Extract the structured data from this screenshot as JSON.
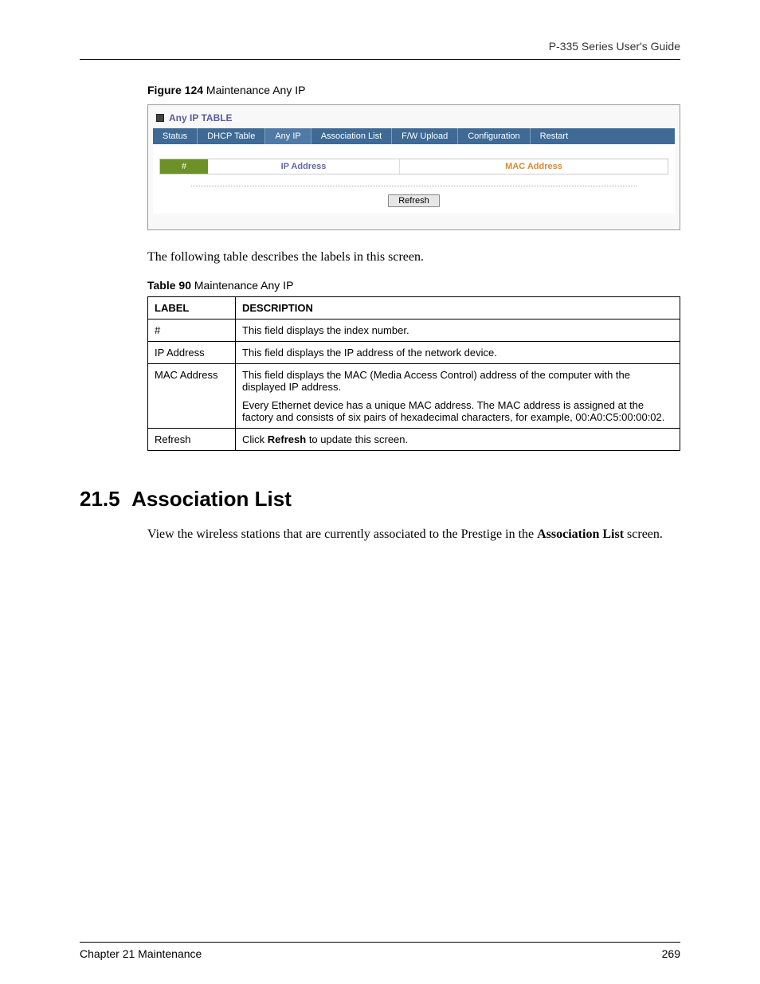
{
  "header": {
    "guide_title": "P-335 Series User's Guide"
  },
  "figure": {
    "caption_bold": "Figure 124",
    "caption_rest": "   Maintenance Any IP",
    "panel_title": "Any IP TABLE",
    "tabs": [
      "Status",
      "DHCP Table",
      "Any IP",
      "Association List",
      "F/W Upload",
      "Configuration",
      "Restart"
    ],
    "active_tab_index": 2,
    "columns": {
      "c1": "#",
      "c2": "IP Address",
      "c3": "MAC Address"
    },
    "refresh_label": "Refresh"
  },
  "intro_text": "The following table describes the labels in this screen.",
  "table": {
    "caption_bold": "Table 90",
    "caption_rest": "   Maintenance Any IP",
    "headers": {
      "label": "LABEL",
      "description": "DESCRIPTION"
    },
    "rows": [
      {
        "label": "#",
        "desc": [
          "This field displays the index number."
        ]
      },
      {
        "label": "IP Address",
        "desc": [
          "This field displays the IP address of the network device."
        ]
      },
      {
        "label": "MAC Address",
        "desc": [
          "This field displays the MAC (Media Access Control) address of the computer with the displayed IP address.",
          "Every Ethernet device has a unique MAC address. The MAC address is assigned at the factory and consists of six pairs of hexadecimal characters, for example, 00:A0:C5:00:00:02."
        ]
      },
      {
        "label": "Refresh",
        "desc_html": {
          "prefix": "Click ",
          "bold": "Refresh",
          "suffix": " to update this screen."
        }
      }
    ]
  },
  "section": {
    "number": "21.5",
    "title": "Association List",
    "body_prefix": "View the wireless stations that are currently associated to the Prestige in the ",
    "body_bold": "Association List",
    "body_suffix": " screen."
  },
  "footer": {
    "left": "Chapter 21 Maintenance",
    "right": "269"
  }
}
